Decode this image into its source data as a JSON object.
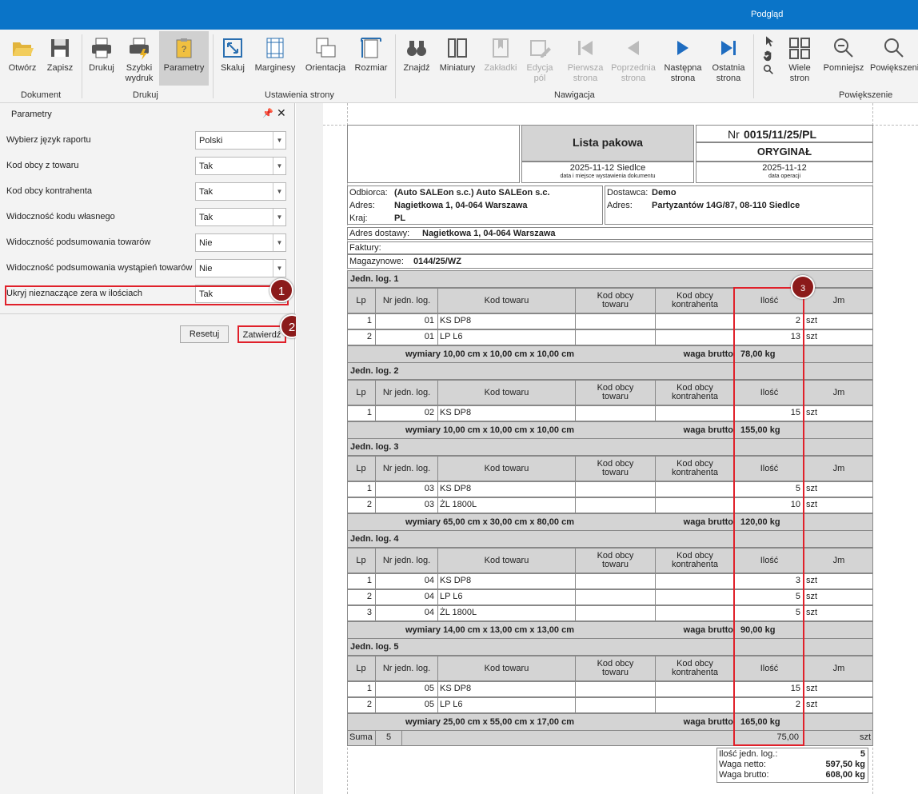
{
  "window": {
    "title": "Podgląd"
  },
  "ribbon": {
    "buttons": [
      {
        "label": "Otwórz",
        "icon": "folder-open-icon"
      },
      {
        "label": "Zapisz",
        "icon": "save-icon"
      },
      {
        "label": "Drukuj",
        "icon": "printer-icon"
      },
      {
        "label": "Szybki wydruk",
        "icon": "quick-print-icon"
      },
      {
        "label": "Parametry",
        "icon": "parameters-icon"
      },
      {
        "label": "Skaluj",
        "icon": "scale-icon"
      },
      {
        "label": "Marginesy",
        "icon": "margins-icon"
      },
      {
        "label": "Orientacja",
        "icon": "orientation-icon"
      },
      {
        "label": "Rozmiar",
        "icon": "page-size-icon"
      },
      {
        "label": "Znajdź",
        "icon": "binoculars-icon"
      },
      {
        "label": "Miniatury",
        "icon": "thumbnails-icon"
      },
      {
        "label": "Zakładki",
        "icon": "bookmark-icon"
      },
      {
        "label": "Edycja pól",
        "icon": "edit-fields-icon"
      },
      {
        "label": "Pierwsza strona",
        "icon": "first-page-icon"
      },
      {
        "label": "Poprzednia strona",
        "icon": "previous-page-icon"
      },
      {
        "label": "Następna strona",
        "icon": "next-page-icon"
      },
      {
        "label": "Ostatnia strona",
        "icon": "last-page-icon"
      },
      {
        "label": "Wiele stron",
        "icon": "multiple-pages-icon"
      },
      {
        "label": "Pomniejsz",
        "icon": "zoom-out-icon"
      },
      {
        "label": "Powiększenie",
        "icon": "zoom-in-icon"
      }
    ],
    "groups": [
      "Dokument",
      "Drukuj",
      "Ustawienia strony",
      "Nawigacja",
      "Powiększenie"
    ]
  },
  "panel": {
    "title": "Parametry",
    "params": [
      {
        "label": "Wybierz język raportu",
        "value": "Polski"
      },
      {
        "label": "Kod obcy z towaru",
        "value": "Tak"
      },
      {
        "label": "Kod obcy kontrahenta",
        "value": "Tak"
      },
      {
        "label": "Widoczność kodu własnego",
        "value": "Tak"
      },
      {
        "label": "Widoczność podsumowania towarów",
        "value": "Nie"
      },
      {
        "label": "Widoczność podsumowania wystąpień towarów",
        "value": "Nie"
      },
      {
        "label": "Ukryj nieznaczące zera w ilościach",
        "value": "Tak"
      }
    ],
    "reset": "Resetuj",
    "confirm": "Zatwierdź",
    "markers": [
      "1",
      "2",
      "3"
    ]
  },
  "report": {
    "title": "Lista pakowa",
    "nr_label": "Nr",
    "nr": "0015/11/25/PL",
    "original": "ORYGINAŁ",
    "issue_date": "2025-11-12  Siedlce",
    "issue_caption": "data i miejsce wystawienia dokumentu",
    "op_date": "2025-11-12",
    "op_caption": "data operacji",
    "recipient_label": "Odbiorca:",
    "recipient": "(Auto SALEon s.c.) Auto SALEon s.c.",
    "address_label": "Adres:",
    "recipient_address": "Nagietkowa 1, 04-064 Warszawa",
    "country_label": "Kraj:",
    "country": "PL",
    "supplier_label": "Dostawca:",
    "supplier": "Demo",
    "supplier_address": "Partyzantów 14G/87, 08-110 Siedlce",
    "delivery_label": "Adres dostawy:",
    "delivery_address": "Nagietkowa 1, 04-064 Warszawa",
    "invoices_label": "Faktury:",
    "warehouse_label": "Magazynowe:",
    "warehouse": "0144/25/WZ",
    "col_headers": [
      "Lp",
      "Nr jedn. log.",
      "Kod towaru",
      "Kod obcy towaru",
      "Kod obcy kontrahenta",
      "Ilość",
      "Jm"
    ],
    "units": [
      {
        "header": "Jedn. log. 1",
        "rows": [
          [
            "1",
            "01",
            "KS DP8",
            "",
            "",
            "2",
            "szt"
          ],
          [
            "2",
            "01",
            "LP L6",
            "",
            "",
            "13",
            "szt"
          ]
        ],
        "dims": "wymiary 10,00 cm x 10,00 cm x 10,00 cm",
        "weight_label": "waga brutto",
        "weight": "78,00 kg"
      },
      {
        "header": "Jedn. log. 2",
        "rows": [
          [
            "1",
            "02",
            "KS DP8",
            "",
            "",
            "15",
            "szt"
          ]
        ],
        "dims": "wymiary 10,00 cm x 10,00 cm x 10,00 cm",
        "weight_label": "waga brutto",
        "weight": "155,00 kg"
      },
      {
        "header": "Jedn. log. 3",
        "rows": [
          [
            "1",
            "03",
            "KS DP8",
            "",
            "",
            "5",
            "szt"
          ],
          [
            "2",
            "03",
            "ŻL 1800L",
            "",
            "",
            "10",
            "szt"
          ]
        ],
        "dims": "wymiary 65,00 cm x 30,00 cm x 80,00 cm",
        "weight_label": "waga brutto",
        "weight": "120,00 kg"
      },
      {
        "header": "Jedn. log. 4",
        "rows": [
          [
            "1",
            "04",
            "KS DP8",
            "",
            "",
            "3",
            "szt"
          ],
          [
            "2",
            "04",
            "LP L6",
            "",
            "",
            "5",
            "szt"
          ],
          [
            "3",
            "04",
            "ŻL 1800L",
            "",
            "",
            "5",
            "szt"
          ]
        ],
        "dims": "wymiary 14,00 cm x 13,00 cm x 13,00 cm",
        "weight_label": "waga brutto",
        "weight": "90,00 kg"
      },
      {
        "header": "Jedn. log. 5",
        "rows": [
          [
            "1",
            "05",
            "KS DP8",
            "",
            "",
            "15",
            "szt"
          ],
          [
            "2",
            "05",
            "LP L6",
            "",
            "",
            "2",
            "szt"
          ]
        ],
        "dims": "wymiary 25,00 cm x 55,00 cm x 17,00 cm",
        "weight_label": "waga brutto",
        "weight": "165,00 kg"
      }
    ],
    "sum_label": "Suma",
    "sum_count": "5",
    "sum_qty": "75,00",
    "sum_unit": "szt",
    "summary": [
      {
        "label": "Ilość jedn. log.:",
        "value": "5"
      },
      {
        "label": "Waga netto:",
        "value": "597,50 kg"
      },
      {
        "label": "Waga brutto:",
        "value": "608,00 kg"
      }
    ]
  }
}
